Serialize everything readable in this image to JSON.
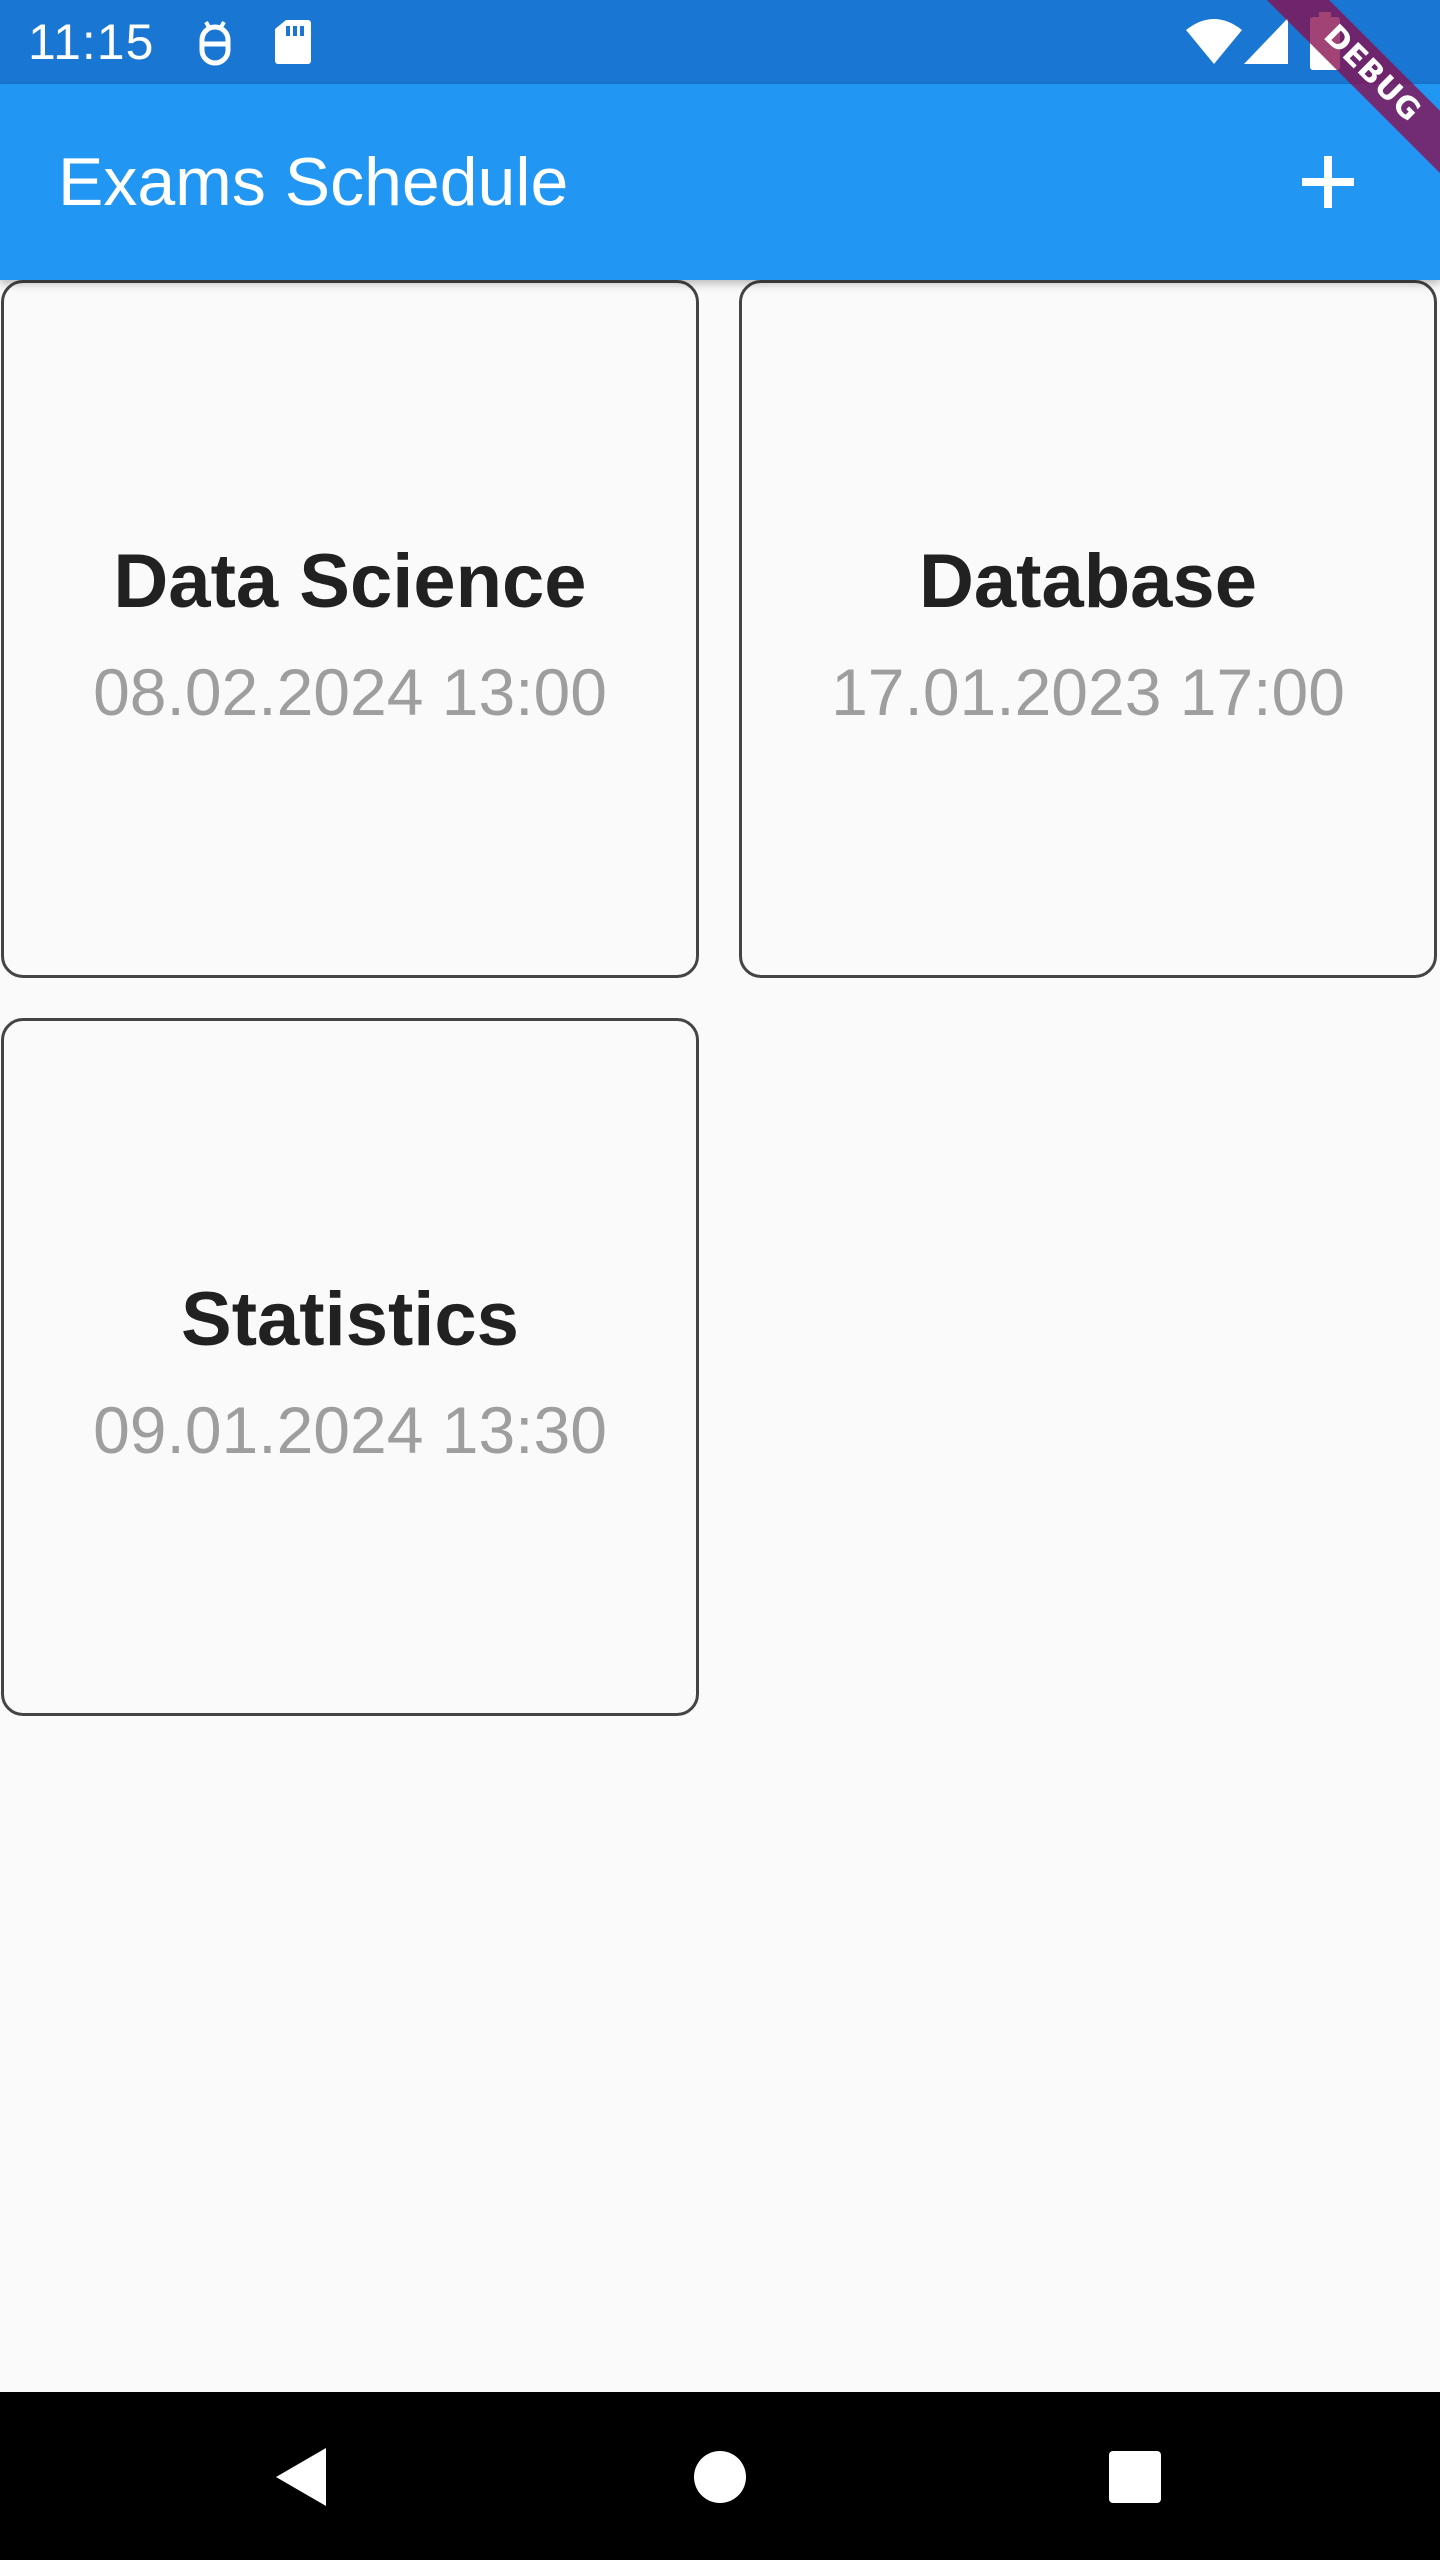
{
  "status_bar": {
    "time": "11:15",
    "icons": [
      "android-debug-icon",
      "sd-card-icon",
      "wifi-icon",
      "signal-icon",
      "battery-icon"
    ],
    "background": "#1976d2"
  },
  "app_bar": {
    "title": "Exams Schedule",
    "action_icon": "plus-icon",
    "background": "#2196f3"
  },
  "debug_banner": {
    "label": "DEBUG"
  },
  "exams": [
    {
      "subject": "Data Science",
      "datetime": "08.02.2024 13:00"
    },
    {
      "subject": "Database",
      "datetime": "17.01.2023 17:00"
    },
    {
      "subject": "Statistics",
      "datetime": "09.01.2024 13:30"
    }
  ],
  "nav_bar": {
    "buttons": [
      "back-icon",
      "home-icon",
      "recents-icon"
    ]
  }
}
